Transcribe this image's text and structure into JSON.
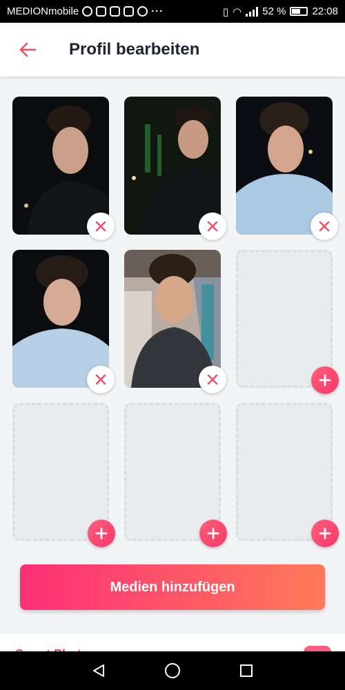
{
  "status_bar": {
    "carrier": "MEDIONmobile",
    "more": "···",
    "battery": "52 %",
    "time": "22:08"
  },
  "header": {
    "title": "Profil bearbeiten"
  },
  "media_grid": {
    "photos_count_filled": 5,
    "slots_total": 9
  },
  "primary_button": {
    "label": "Medien hinzufügen"
  },
  "next_section": {
    "label": "Smart Photos"
  },
  "colors": {
    "accent": "#fd3a6a",
    "gradient_start": "#fd2f77",
    "gradient_end": "#ff7a59",
    "empty_tile": "#e9ebef"
  }
}
